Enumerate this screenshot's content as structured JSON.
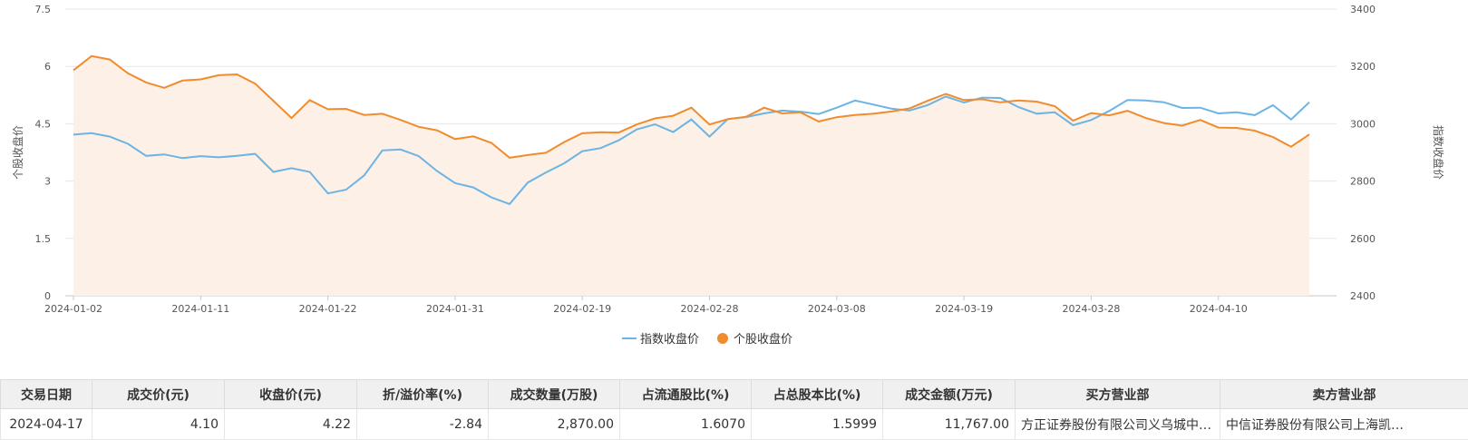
{
  "chart_data": {
    "type": "area",
    "x": [
      "2024-01-02",
      "2024-01-03",
      "2024-01-04",
      "2024-01-05",
      "2024-01-08",
      "2024-01-09",
      "2024-01-10",
      "2024-01-11",
      "2024-01-12",
      "2024-01-15",
      "2024-01-16",
      "2024-01-17",
      "2024-01-18",
      "2024-01-19",
      "2024-01-22",
      "2024-01-23",
      "2024-01-24",
      "2024-01-25",
      "2024-01-26",
      "2024-01-29",
      "2024-01-30",
      "2024-01-31",
      "2024-02-01",
      "2024-02-02",
      "2024-02-05",
      "2024-02-06",
      "2024-02-07",
      "2024-02-08",
      "2024-02-19",
      "2024-02-20",
      "2024-02-21",
      "2024-02-22",
      "2024-02-23",
      "2024-02-26",
      "2024-02-27",
      "2024-02-28",
      "2024-02-29",
      "2024-03-01",
      "2024-03-04",
      "2024-03-05",
      "2024-03-06",
      "2024-03-07",
      "2024-03-08",
      "2024-03-11",
      "2024-03-12",
      "2024-03-13",
      "2024-03-14",
      "2024-03-15",
      "2024-03-18",
      "2024-03-19",
      "2024-03-20",
      "2024-03-21",
      "2024-03-22",
      "2024-03-25",
      "2024-03-26",
      "2024-03-27",
      "2024-03-28",
      "2024-03-29",
      "2024-04-01",
      "2024-04-02",
      "2024-04-03",
      "2024-04-08",
      "2024-04-09",
      "2024-04-10",
      "2024-04-11",
      "2024-04-12",
      "2024-04-15",
      "2024-04-16",
      "2024-04-17",
      "2024-04-18"
    ],
    "x_tick_labels": [
      "2024-01-02",
      "2024-01-11",
      "2024-01-22",
      "2024-01-31",
      "2024-02-19",
      "2024-02-28",
      "2024-03-08",
      "2024-03-19",
      "2024-03-28",
      "2024-04-10"
    ],
    "series": [
      {
        "name": "指数收盘价",
        "axis": "right",
        "color": "#6cb4e4",
        "values": [
          2962,
          2967,
          2955,
          2930,
          2888,
          2893,
          2880,
          2887,
          2883,
          2888,
          2895,
          2832,
          2845,
          2832,
          2757,
          2770,
          2820,
          2907,
          2910,
          2887,
          2835,
          2793,
          2778,
          2743,
          2720,
          2795,
          2830,
          2862,
          2904,
          2915,
          2942,
          2980,
          2998,
          2971,
          3015,
          2955,
          3016,
          3023,
          3036,
          3046,
          3042,
          3034,
          3056,
          3081,
          3067,
          3053,
          3046,
          3065,
          3095,
          3074,
          3091,
          3090,
          3058,
          3035,
          3040,
          2995,
          3013,
          3045,
          3083,
          3081,
          3075,
          3055,
          3056,
          3036,
          3040,
          3030,
          3065,
          3015,
          3075
        ]
      },
      {
        "name": "个股收盘价",
        "axis": "left",
        "color": "#f08c2e",
        "values": [
          5.9,
          6.27,
          6.18,
          5.82,
          5.58,
          5.44,
          5.63,
          5.66,
          5.77,
          5.79,
          5.55,
          5.1,
          4.65,
          5.12,
          4.88,
          4.89,
          4.73,
          4.76,
          4.6,
          4.42,
          4.33,
          4.1,
          4.17,
          4.0,
          3.61,
          3.68,
          3.74,
          4.02,
          4.25,
          4.28,
          4.27,
          4.48,
          4.64,
          4.71,
          4.92,
          4.48,
          4.62,
          4.68,
          4.92,
          4.77,
          4.8,
          4.56,
          4.67,
          4.73,
          4.76,
          4.82,
          4.9,
          5.1,
          5.28,
          5.12,
          5.14,
          5.06,
          5.11,
          5.08,
          4.96,
          4.58,
          4.78,
          4.72,
          4.84,
          4.65,
          4.52,
          4.45,
          4.6,
          4.4,
          4.39,
          4.32,
          4.15,
          3.9,
          4.22
        ]
      }
    ],
    "y_left": {
      "label": "个股收盘价",
      "ylim": [
        0,
        7.5
      ],
      "ticks": [
        "0",
        "1.5",
        "3",
        "4.5",
        "6",
        "7.5"
      ]
    },
    "y_right": {
      "label": "指数收盘价",
      "ylim": [
        2400,
        3400
      ],
      "ticks": [
        "2400",
        "2600",
        "2800",
        "3000",
        "3200",
        "3400"
      ]
    },
    "area_fill": "#fdf0e6",
    "grid": true,
    "legend_position": "bottom-center"
  },
  "legend": [
    {
      "label": "指数收盘价",
      "color": "#6cb4e4"
    },
    {
      "label": "个股收盘价",
      "color": "#f08c2e"
    }
  ],
  "table": {
    "headers": [
      "交易日期",
      "成交价(元)",
      "收盘价(元)",
      "折/溢价率(%)",
      "成交数量(万股)",
      "占流通股比(%)",
      "占总股本比(%)",
      "成交金额(万元)",
      "买方营业部",
      "卖方营业部"
    ],
    "rows": [
      [
        "2024-04-17",
        "4.10",
        "4.22",
        "-2.84",
        "2,870.00",
        "1.6070",
        "1.5999",
        "11,767.00",
        "方正证券股份有限公司义乌城中…",
        "中信证券股份有限公司上海凯…"
      ]
    ]
  }
}
